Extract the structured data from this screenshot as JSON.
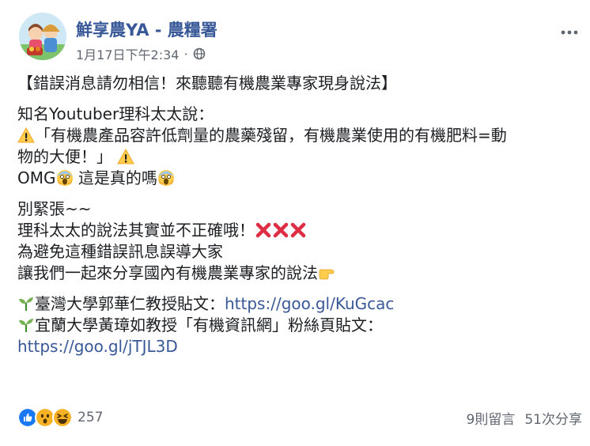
{
  "page": {
    "name": "鮮享農YA - 農糧署",
    "timestamp": "1月17日下午2:34",
    "separator": "·"
  },
  "post": {
    "title": "【錯誤消息請勿相信！來聽聽有機農業專家現身說法】",
    "p1": "知名Youtuber理科太太說：",
    "quote1": "「有機農產品容許低劑量的農藥殘留，有機農業使用的有機肥料=動",
    "quote2": "物的大便！」",
    "omg_a": "OMG",
    "omg_b": " 這是真的嗎",
    "p2": "別緊張~~",
    "p3": "理科太太的說法其實並不正確哦！",
    "p4": "為避免這種錯誤訊息誤導大家",
    "p5": "讓我們一起來分享國內有機農業專家的說法",
    "link1_text": "臺灣大學郭華仁教授貼文：",
    "link1_url": "https://goo.gl/KuGcac",
    "link2_text": "宜蘭大學黃璋如教授「有機資訊網」粉絲頁貼文：",
    "link2_url": "https://goo.gl/jTJL3D"
  },
  "footer": {
    "reaction_count": "257",
    "comments": "9則留言",
    "shares": "51次分享"
  },
  "colors": {
    "link": "#385898",
    "meta": "#606770",
    "like": "#1877f2",
    "haha": "#f7b125",
    "x": "#dd2e44"
  }
}
